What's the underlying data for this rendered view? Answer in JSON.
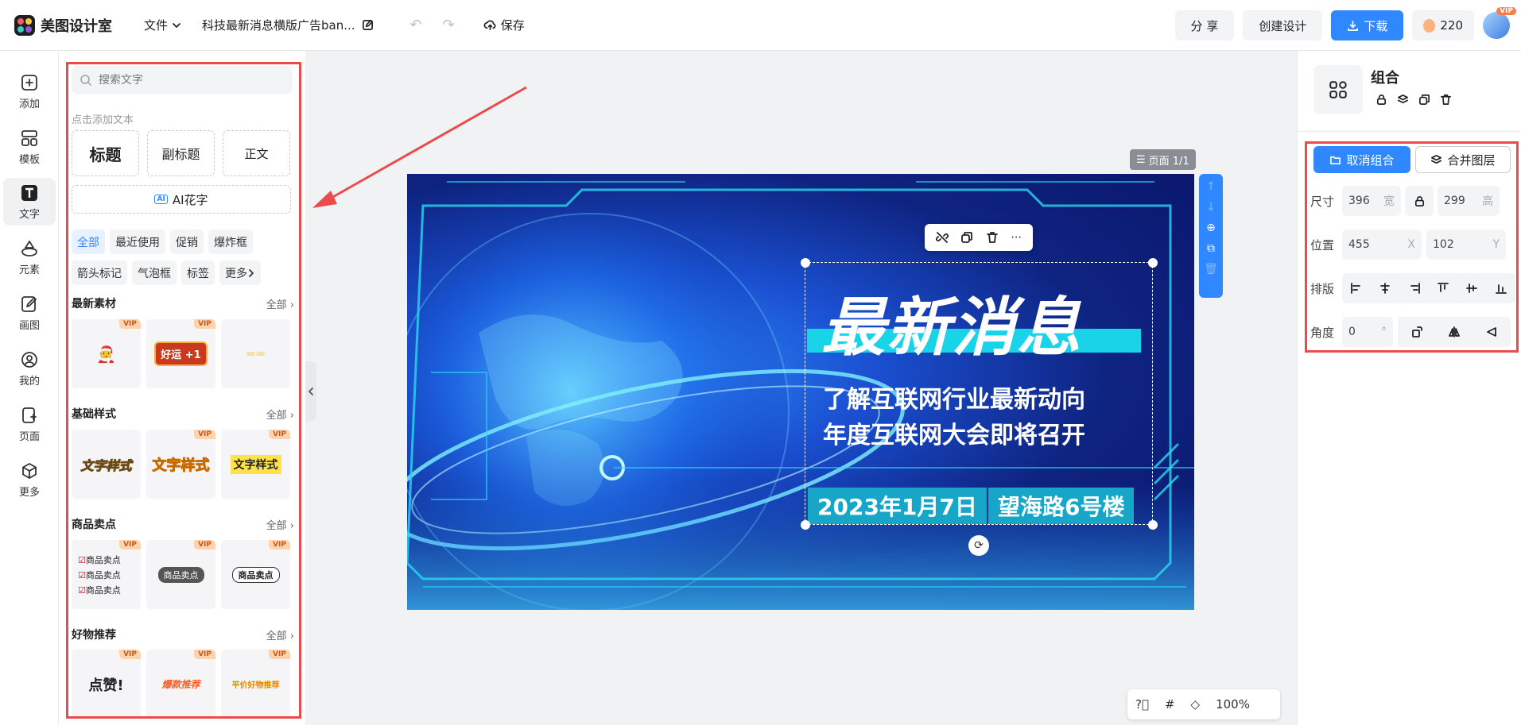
{
  "header": {
    "app_name": "美图设计室",
    "file_menu": "文件",
    "doc_title": "科技最新消息横版广告ban...",
    "save": "保存",
    "share": "分 享",
    "create": "创建设计",
    "download": "下载",
    "coins": "220",
    "vip": "VIP"
  },
  "rail": {
    "items": [
      {
        "label": "添加",
        "icon": "plus-square-icon"
      },
      {
        "label": "模板",
        "icon": "template-icon"
      },
      {
        "label": "文字",
        "icon": "text-icon"
      },
      {
        "label": "元素",
        "icon": "shapes-icon"
      },
      {
        "label": "画图",
        "icon": "draw-icon"
      },
      {
        "label": "我的",
        "icon": "user-icon"
      },
      {
        "label": "页面",
        "icon": "page-icon"
      },
      {
        "label": "更多",
        "icon": "cube-icon"
      }
    ]
  },
  "panel": {
    "search_placeholder": "搜索文字",
    "add_hint": "点击添加文本",
    "title_card": "标题",
    "subtitle_card": "副标题",
    "body_card": "正文",
    "ai_tag": "AI",
    "ai_card": "AI花字",
    "chips": [
      "全部",
      "最近使用",
      "促销",
      "爆炸框",
      "箭头标记",
      "气泡框",
      "标签",
      "更多"
    ],
    "sections": [
      {
        "title": "最新素材",
        "all": "全部"
      },
      {
        "title": "基础样式",
        "all": "全部"
      },
      {
        "title": "商品卖点",
        "all": "全部"
      },
      {
        "title": "好物推荐",
        "all": "全部"
      }
    ],
    "vip": "VIP",
    "tile_texts": {
      "lucky": "好运 +1",
      "style1": "文字样式",
      "style2": "文字样式",
      "style3": "文字样式",
      "point1": "商品卖点",
      "point2": "商品卖点",
      "point3": "商品卖点",
      "point_pill": "商品卖点",
      "point_badge": "商品卖点",
      "like": "点赞!",
      "rec": "爆款推荐",
      "cheap": "平价好物推荐"
    }
  },
  "canvas": {
    "page_label": "页面 1/1",
    "headline": "最新消息",
    "sub1": "了解互联网行业最新动向",
    "sub2": "年度互联网大会即将召开",
    "date": "2023年1月7日",
    "location": "望海路6号楼",
    "zoom": "100%"
  },
  "inspector": {
    "title": "组合",
    "ungroup": "取消组合",
    "merge": "合并图层",
    "size_label": "尺寸",
    "width": "396",
    "width_unit": "宽",
    "height": "299",
    "height_unit": "高",
    "pos_label": "位置",
    "x": "455",
    "x_unit": "X",
    "y": "102",
    "y_unit": "Y",
    "align_label": "排版",
    "angle_label": "角度",
    "angle": "0",
    "angle_unit": "°"
  },
  "colors": {
    "accent": "#2f88ff",
    "highlight": "#ec4b4b",
    "banner_cyan": "#19d4e8"
  }
}
